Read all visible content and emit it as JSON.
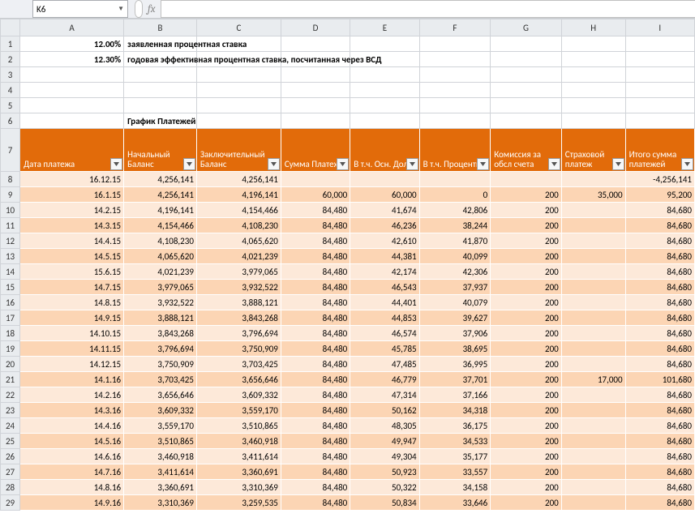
{
  "name_box": {
    "value": "K6"
  },
  "fx": {
    "label": "fx",
    "value": ""
  },
  "cols": [
    "A",
    "B",
    "C",
    "D",
    "E",
    "F",
    "G",
    "H",
    "I"
  ],
  "header_rows": [
    {
      "row": "1",
      "A_num": "12.00%",
      "B_text": "заявленная процентная ставка"
    },
    {
      "row": "2",
      "A_num": "12.30%",
      "B_text": "годовая эффективная процентная ставка, посчитанная через ВСД"
    },
    {
      "row": "3"
    },
    {
      "row": "4"
    },
    {
      "row": "5"
    },
    {
      "row": "6",
      "B_text": "График Платежей"
    }
  ],
  "table_headers": {
    "row": "7",
    "cols": [
      "Дата платежа",
      "Начальный Баланс",
      "Заключительный Баланс",
      "Сумма Платежа",
      "В т.ч. Осн. Долг",
      "В т.ч. Проценты",
      "Комиссия за обсл счета",
      "Страховой платеж",
      "Итого сумма платежей"
    ]
  },
  "rows": [
    {
      "r": "8",
      "band": "light",
      "cells": [
        "16.12.15",
        "4,256,141",
        "4,256,141",
        "",
        "",
        "",
        "",
        "",
        "-4,256,141"
      ]
    },
    {
      "r": "9",
      "band": "dark",
      "cells": [
        "16.1.15",
        "4,256,141",
        "4,196,141",
        "60,000",
        "60,000",
        "0",
        "200",
        "35,000",
        "95,200"
      ]
    },
    {
      "r": "10",
      "band": "light",
      "cells": [
        "14.2.15",
        "4,196,141",
        "4,154,466",
        "84,480",
        "41,674",
        "42,806",
        "200",
        "",
        "84,680"
      ]
    },
    {
      "r": "11",
      "band": "dark",
      "cells": [
        "14.3.15",
        "4,154,466",
        "4,108,230",
        "84,480",
        "46,236",
        "38,244",
        "200",
        "",
        "84,680"
      ]
    },
    {
      "r": "12",
      "band": "light",
      "cells": [
        "14.4.15",
        "4,108,230",
        "4,065,620",
        "84,480",
        "42,610",
        "41,870",
        "200",
        "",
        "84,680"
      ]
    },
    {
      "r": "13",
      "band": "dark",
      "cells": [
        "14.5.15",
        "4,065,620",
        "4,021,239",
        "84,480",
        "44,381",
        "40,099",
        "200",
        "",
        "84,680"
      ]
    },
    {
      "r": "14",
      "band": "light",
      "cells": [
        "15.6.15",
        "4,021,239",
        "3,979,065",
        "84,480",
        "42,174",
        "42,306",
        "200",
        "",
        "84,680"
      ]
    },
    {
      "r": "15",
      "band": "dark",
      "cells": [
        "14.7.15",
        "3,979,065",
        "3,932,522",
        "84,480",
        "46,543",
        "37,937",
        "200",
        "",
        "84,680"
      ]
    },
    {
      "r": "16",
      "band": "light",
      "cells": [
        "14.8.15",
        "3,932,522",
        "3,888,121",
        "84,480",
        "44,401",
        "40,079",
        "200",
        "",
        "84,680"
      ]
    },
    {
      "r": "17",
      "band": "dark",
      "cells": [
        "14.9.15",
        "3,888,121",
        "3,843,268",
        "84,480",
        "44,853",
        "39,627",
        "200",
        "",
        "84,680"
      ]
    },
    {
      "r": "18",
      "band": "light",
      "cells": [
        "14.10.15",
        "3,843,268",
        "3,796,694",
        "84,480",
        "46,574",
        "37,906",
        "200",
        "",
        "84,680"
      ]
    },
    {
      "r": "19",
      "band": "dark",
      "cells": [
        "14.11.15",
        "3,796,694",
        "3,750,909",
        "84,480",
        "45,785",
        "38,695",
        "200",
        "",
        "84,680"
      ]
    },
    {
      "r": "20",
      "band": "light",
      "cells": [
        "14.12.15",
        "3,750,909",
        "3,703,425",
        "84,480",
        "47,485",
        "36,995",
        "200",
        "",
        "84,680"
      ]
    },
    {
      "r": "21",
      "band": "dark",
      "cells": [
        "14.1.16",
        "3,703,425",
        "3,656,646",
        "84,480",
        "46,779",
        "37,701",
        "200",
        "17,000",
        "101,680"
      ]
    },
    {
      "r": "22",
      "band": "light",
      "cells": [
        "14.2.16",
        "3,656,646",
        "3,609,332",
        "84,480",
        "47,314",
        "37,166",
        "200",
        "",
        "84,680"
      ]
    },
    {
      "r": "23",
      "band": "dark",
      "cells": [
        "14.3.16",
        "3,609,332",
        "3,559,170",
        "84,480",
        "50,162",
        "34,318",
        "200",
        "",
        "84,680"
      ]
    },
    {
      "r": "24",
      "band": "light",
      "cells": [
        "14.4.16",
        "3,559,170",
        "3,510,865",
        "84,480",
        "48,305",
        "36,175",
        "200",
        "",
        "84,680"
      ]
    },
    {
      "r": "25",
      "band": "dark",
      "cells": [
        "14.5.16",
        "3,510,865",
        "3,460,918",
        "84,480",
        "49,947",
        "34,533",
        "200",
        "",
        "84,680"
      ]
    },
    {
      "r": "26",
      "band": "light",
      "cells": [
        "14.6.16",
        "3,460,918",
        "3,411,614",
        "84,480",
        "49,304",
        "35,177",
        "200",
        "",
        "84,680"
      ]
    },
    {
      "r": "27",
      "band": "dark",
      "cells": [
        "14.7.16",
        "3,411,614",
        "3,360,691",
        "84,480",
        "50,923",
        "33,557",
        "200",
        "",
        "84,680"
      ]
    },
    {
      "r": "28",
      "band": "light",
      "cells": [
        "14.8.16",
        "3,360,691",
        "3,310,369",
        "84,480",
        "50,322",
        "34,158",
        "200",
        "",
        "84,680"
      ]
    },
    {
      "r": "29",
      "band": "dark",
      "cells": [
        "14.9.16",
        "3,310,369",
        "3,259,535",
        "84,480",
        "50,834",
        "33,646",
        "200",
        "",
        "84,680"
      ]
    }
  ]
}
